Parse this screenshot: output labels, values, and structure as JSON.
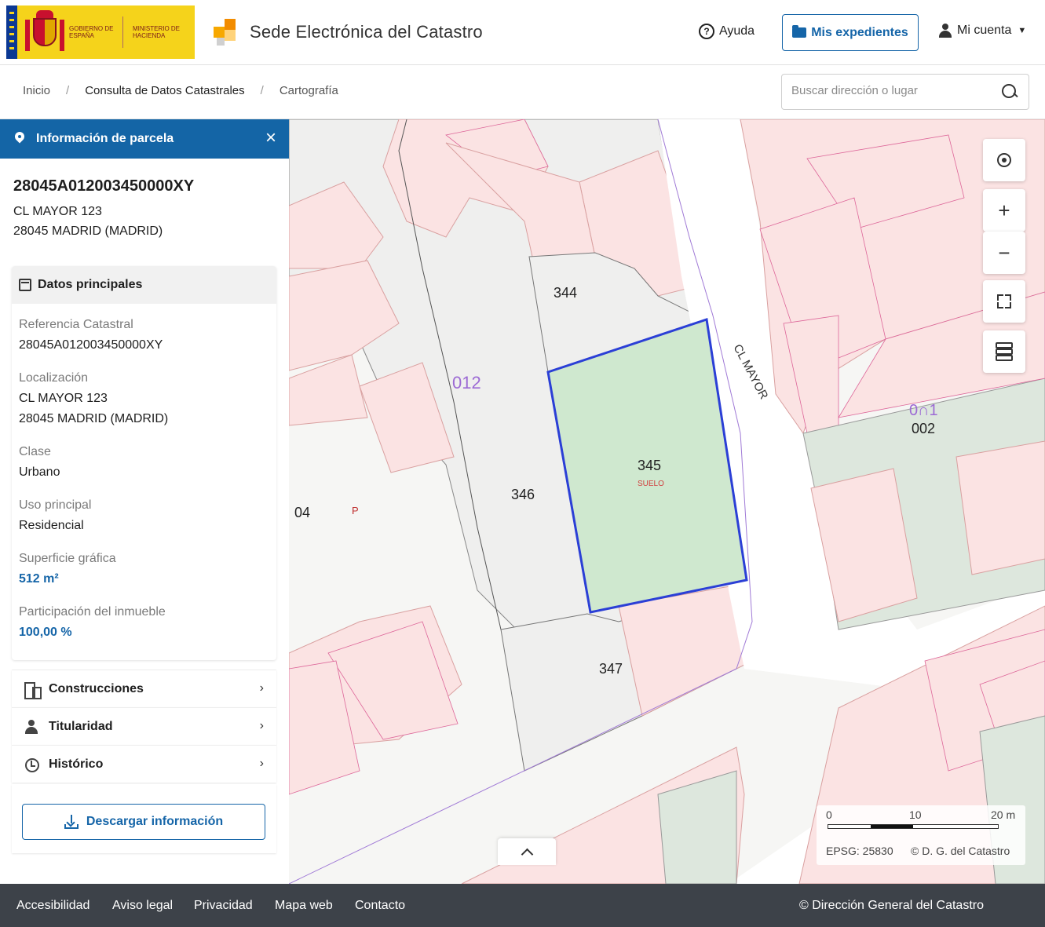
{
  "header": {
    "gov_line1": "Gobierno de España",
    "gov_line2": "Ministerio de Hacienda",
    "site_title": "Sede Electrónica del Catastro",
    "help_label": "Ayuda",
    "expedientes_label": "Mis expedientes",
    "account_label": "Mi cuenta"
  },
  "breadcrumb": {
    "items": [
      "Inicio",
      "Consulta de Datos Catastrales",
      "Cartografía"
    ]
  },
  "search": {
    "placeholder": "Buscar dirección o lugar"
  },
  "panel": {
    "title": "Información de parcela",
    "close": "×",
    "reference": "28045A012003450000XY",
    "address_line1": "CL MAYOR 123",
    "address_line2": "28045 MADRID (MADRID)",
    "section_title": "Datos principales",
    "fields": [
      {
        "label": "Referencia Catastral",
        "value": "28045A012003450000XY"
      },
      {
        "label": "Localización",
        "value": "CL MAYOR 123",
        "value2": "28045 MADRID (MADRID)"
      },
      {
        "label": "Clase",
        "value": "Urbano"
      },
      {
        "label": "Uso principal",
        "value": "Residencial"
      },
      {
        "label": "Superficie gráfica",
        "value": "512 m²"
      },
      {
        "label": "Participación del inmueble",
        "value": "100,00 %"
      }
    ],
    "accordions": [
      "Construcciones",
      "Titularidad",
      "Histórico"
    ],
    "download_label": "Descargar información"
  },
  "map": {
    "labels": {
      "p344": "344",
      "p345": "345",
      "suelo": "SUELO",
      "p346": "346",
      "p347": "347",
      "p012": "012",
      "p04": "04",
      "p001": "0∩1",
      "p002": "002",
      "street": "CL MAYOR",
      "p_letter": "P"
    },
    "highlight_color": "#2b3fd6",
    "highlight_fill": "#cfe8cf",
    "zoom_in": "+",
    "zoom_out": "−",
    "scale": {
      "t0": "0",
      "t10": "10",
      "t20": "20 m",
      "epsg": "EPSG: 25830",
      "credit": "© D. G. del Catastro"
    }
  },
  "footer": {
    "links": [
      "Accesibilidad",
      "Aviso legal",
      "Privacidad",
      "Mapa web",
      "Contacto"
    ],
    "copyright": "© Dirección General del Catastro"
  }
}
